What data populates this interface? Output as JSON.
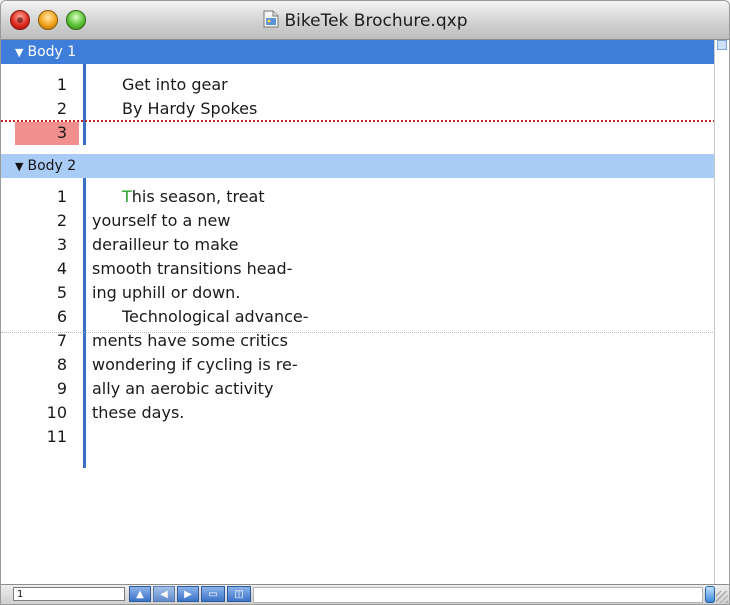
{
  "window": {
    "title": "BikeTek Brochure.qxp"
  },
  "sections": [
    {
      "label": "Body 1",
      "lines": [
        {
          "num": "1",
          "text": "Get into gear"
        },
        {
          "num": "2",
          "text": "By Hardy Spokes"
        },
        {
          "num": "3",
          "text": ""
        }
      ]
    },
    {
      "label": "Body 2",
      "lines": [
        {
          "num": "1",
          "text": "This season, treat",
          "first_letter": "T",
          "rest": "his season, treat"
        },
        {
          "num": "2",
          "text": "yourself to a new"
        },
        {
          "num": "3",
          "text": "derailleur to make"
        },
        {
          "num": "4",
          "text": "smooth transitions head-"
        },
        {
          "num": "5",
          "text": "ing uphill or down."
        },
        {
          "num": "6",
          "text": "Technological advance-"
        },
        {
          "num": "7",
          "text": "ments have some critics"
        },
        {
          "num": "8",
          "text": "wondering if cycling is re-"
        },
        {
          "num": "9",
          "text": "ally an aerobic activity"
        },
        {
          "num": "10",
          "text": "these days."
        },
        {
          "num": "11",
          "text": ""
        }
      ]
    }
  ],
  "statusbar": {
    "page_field": "1"
  },
  "colors": {
    "active_header": "#3f7ddb",
    "inactive_header": "#a9ccf7",
    "line_number_highlight": "#f18e8e",
    "dotted_overflow": "#cc2222",
    "first_char_marker": "#2aa12a"
  },
  "icons": {
    "document": "document-icon",
    "close": "close-button",
    "minimize": "minimize-button",
    "zoom": "zoom-button"
  }
}
